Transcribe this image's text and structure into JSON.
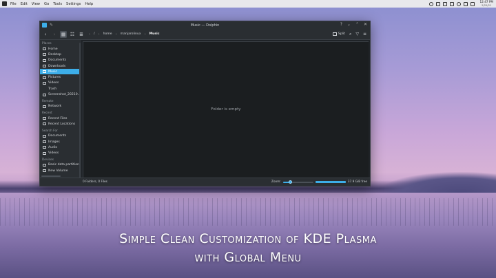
{
  "panel": {
    "menu": [
      "File",
      "Edit",
      "View",
      "Go",
      "Tools",
      "Settings",
      "Help"
    ],
    "clock": {
      "time": "12:47 PM",
      "date": "5/25/21"
    }
  },
  "window": {
    "title": "Music — Dolphin",
    "controls": [
      "?",
      "⌄",
      "⌃",
      "✕"
    ]
  },
  "toolbar": {
    "back_icon": "back-arrow-icon",
    "breadcrumb": [
      "/",
      "home",
      "manjarolinux",
      "Music"
    ],
    "split_label": "Split"
  },
  "sidebar": {
    "groups": [
      {
        "label": "Places",
        "items": [
          {
            "label": "Home",
            "icon": "home-icon"
          },
          {
            "label": "Desktop",
            "icon": "desktop-icon"
          },
          {
            "label": "Documents",
            "icon": "documents-icon"
          },
          {
            "label": "Downloads",
            "icon": "downloads-icon"
          },
          {
            "label": "Music",
            "icon": "music-icon",
            "selected": true
          },
          {
            "label": "Pictures",
            "icon": "pictures-icon"
          },
          {
            "label": "Videos",
            "icon": "videos-icon"
          },
          {
            "label": "Trash",
            "icon": ""
          },
          {
            "label": "Screenshot_20210...",
            "icon": "image-icon"
          }
        ]
      },
      {
        "label": "Remote",
        "items": [
          {
            "label": "Network",
            "icon": "network-icon"
          }
        ]
      },
      {
        "label": "Recent",
        "items": [
          {
            "label": "Recent Files",
            "icon": "recent-files-icon"
          },
          {
            "label": "Recent Locations",
            "icon": "recent-locations-icon"
          }
        ]
      },
      {
        "label": "Search For",
        "items": [
          {
            "label": "Documents",
            "icon": "documents-icon"
          },
          {
            "label": "Images",
            "icon": "images-icon"
          },
          {
            "label": "Audio",
            "icon": "audio-icon"
          },
          {
            "label": "Videos",
            "icon": "videos-icon"
          }
        ]
      },
      {
        "label": "Devices",
        "items": [
          {
            "label": "Basic data partition",
            "icon": "drive-icon"
          },
          {
            "label": "New Volume",
            "icon": "drive-icon"
          }
        ]
      }
    ]
  },
  "main": {
    "empty_text": "Folder is empty"
  },
  "status": {
    "summary": "0 Folders, 0 Files",
    "zoom_label": "Zoom:",
    "zoom_fraction": 0.25,
    "free_space": "37.9 GiB free"
  },
  "caption": {
    "line1": "Simple Clean Customization of KDE Plasma",
    "line2": "with Global Menu"
  },
  "colors": {
    "accent": "#3daee9",
    "window_bg": "#1b1e20",
    "panel_bg": "#e8e8ec"
  }
}
